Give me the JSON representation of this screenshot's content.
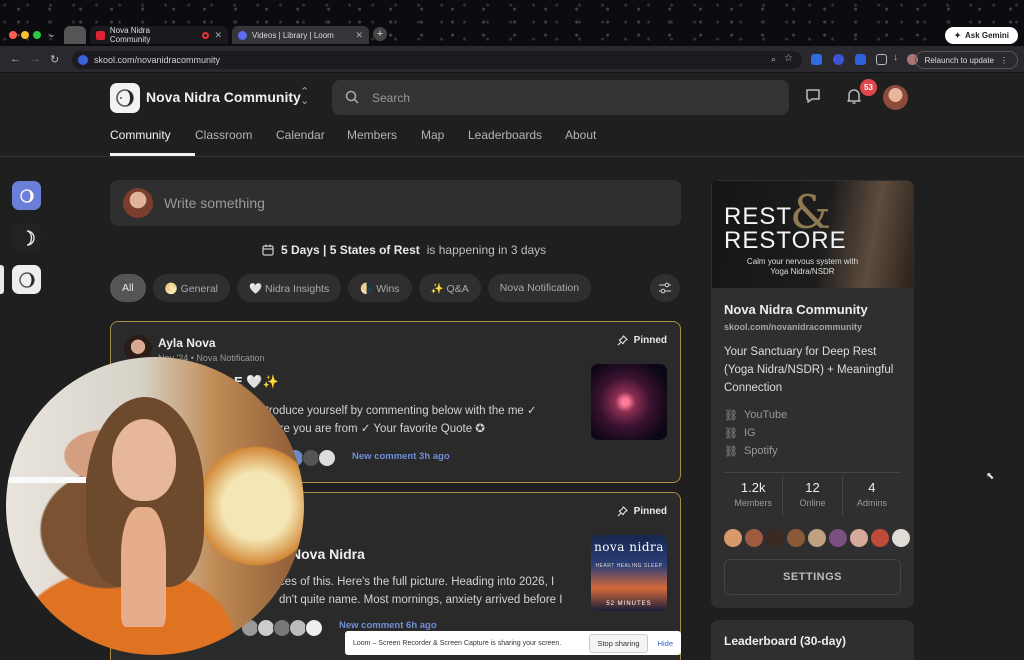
{
  "browser": {
    "tabs": [
      {
        "label": "Nova Nidra Community"
      },
      {
        "label": "Videos | Library | Loom"
      }
    ],
    "url": "skool.com/novanidracommunity",
    "ask_gemini": "Ask Gemini",
    "relaunch": "Relaunch to update"
  },
  "header": {
    "community_name": "Nova Nidra Community",
    "search_placeholder": "Search",
    "notification_count": "53"
  },
  "nav_tabs": [
    "Community",
    "Classroom",
    "Calendar",
    "Members",
    "Map",
    "Leaderboards",
    "About"
  ],
  "composer": {
    "placeholder": "Write something"
  },
  "event_banner": {
    "name": "5 Days | 5 States of Rest",
    "suffix": "is happening in 3 days"
  },
  "filters": [
    "All",
    "🌕 General",
    "🤍 Nidra Insights",
    "🌗 Wins",
    "✨ Q&A",
    "Nova Notification"
  ],
  "posts": [
    {
      "author": "Ayla Nova",
      "meta": "Nov '24 • Nova Notification",
      "pinned": "Pinned",
      "title_fragment": "E 🤍✨",
      "body": "Introduce yourself by commenting below with the me ✓ Where you are from ✓ Your favorite Quote ✪",
      "last_comment": "New comment 3h ago"
    },
    {
      "pinned": "Pinned",
      "title_fragment": "Nova Nidra",
      "body": "ces of this. Here's the full picture. Heading into 2026, I dn't quite name. Most mornings, anxiety arrived before I",
      "last_comment": "New comment 6h ago",
      "thumb_title": "nova nidra",
      "thumb_subtitle": "HEART HEALING SLEEP",
      "thumb_duration": "52 MINUTES"
    }
  ],
  "about_card": {
    "banner_line1": "REST",
    "banner_line2": "RESTORE",
    "banner_amp": "&",
    "banner_tagline": "Calm your nervous system with Yoga Nidra/NSDR",
    "name": "Nova Nidra Community",
    "url": "skool.com/novanidracommunity",
    "description": "Your Sanctuary for Deep Rest (Yoga Nidra/NSDR) + Meaningful Connection",
    "links": [
      "YouTube",
      "IG",
      "Spotify"
    ],
    "stats": [
      {
        "value": "1.2k",
        "label": "Members"
      },
      {
        "value": "12",
        "label": "Online"
      },
      {
        "value": "4",
        "label": "Admins"
      }
    ],
    "settings_label": "SETTINGS"
  },
  "leaderboard": {
    "title": "Leaderboard (30-day)"
  },
  "loom": {
    "message": "Loom – Screen Recorder & Screen Capture is sharing your screen.",
    "stop": "Stop sharing",
    "hide": "Hide"
  }
}
